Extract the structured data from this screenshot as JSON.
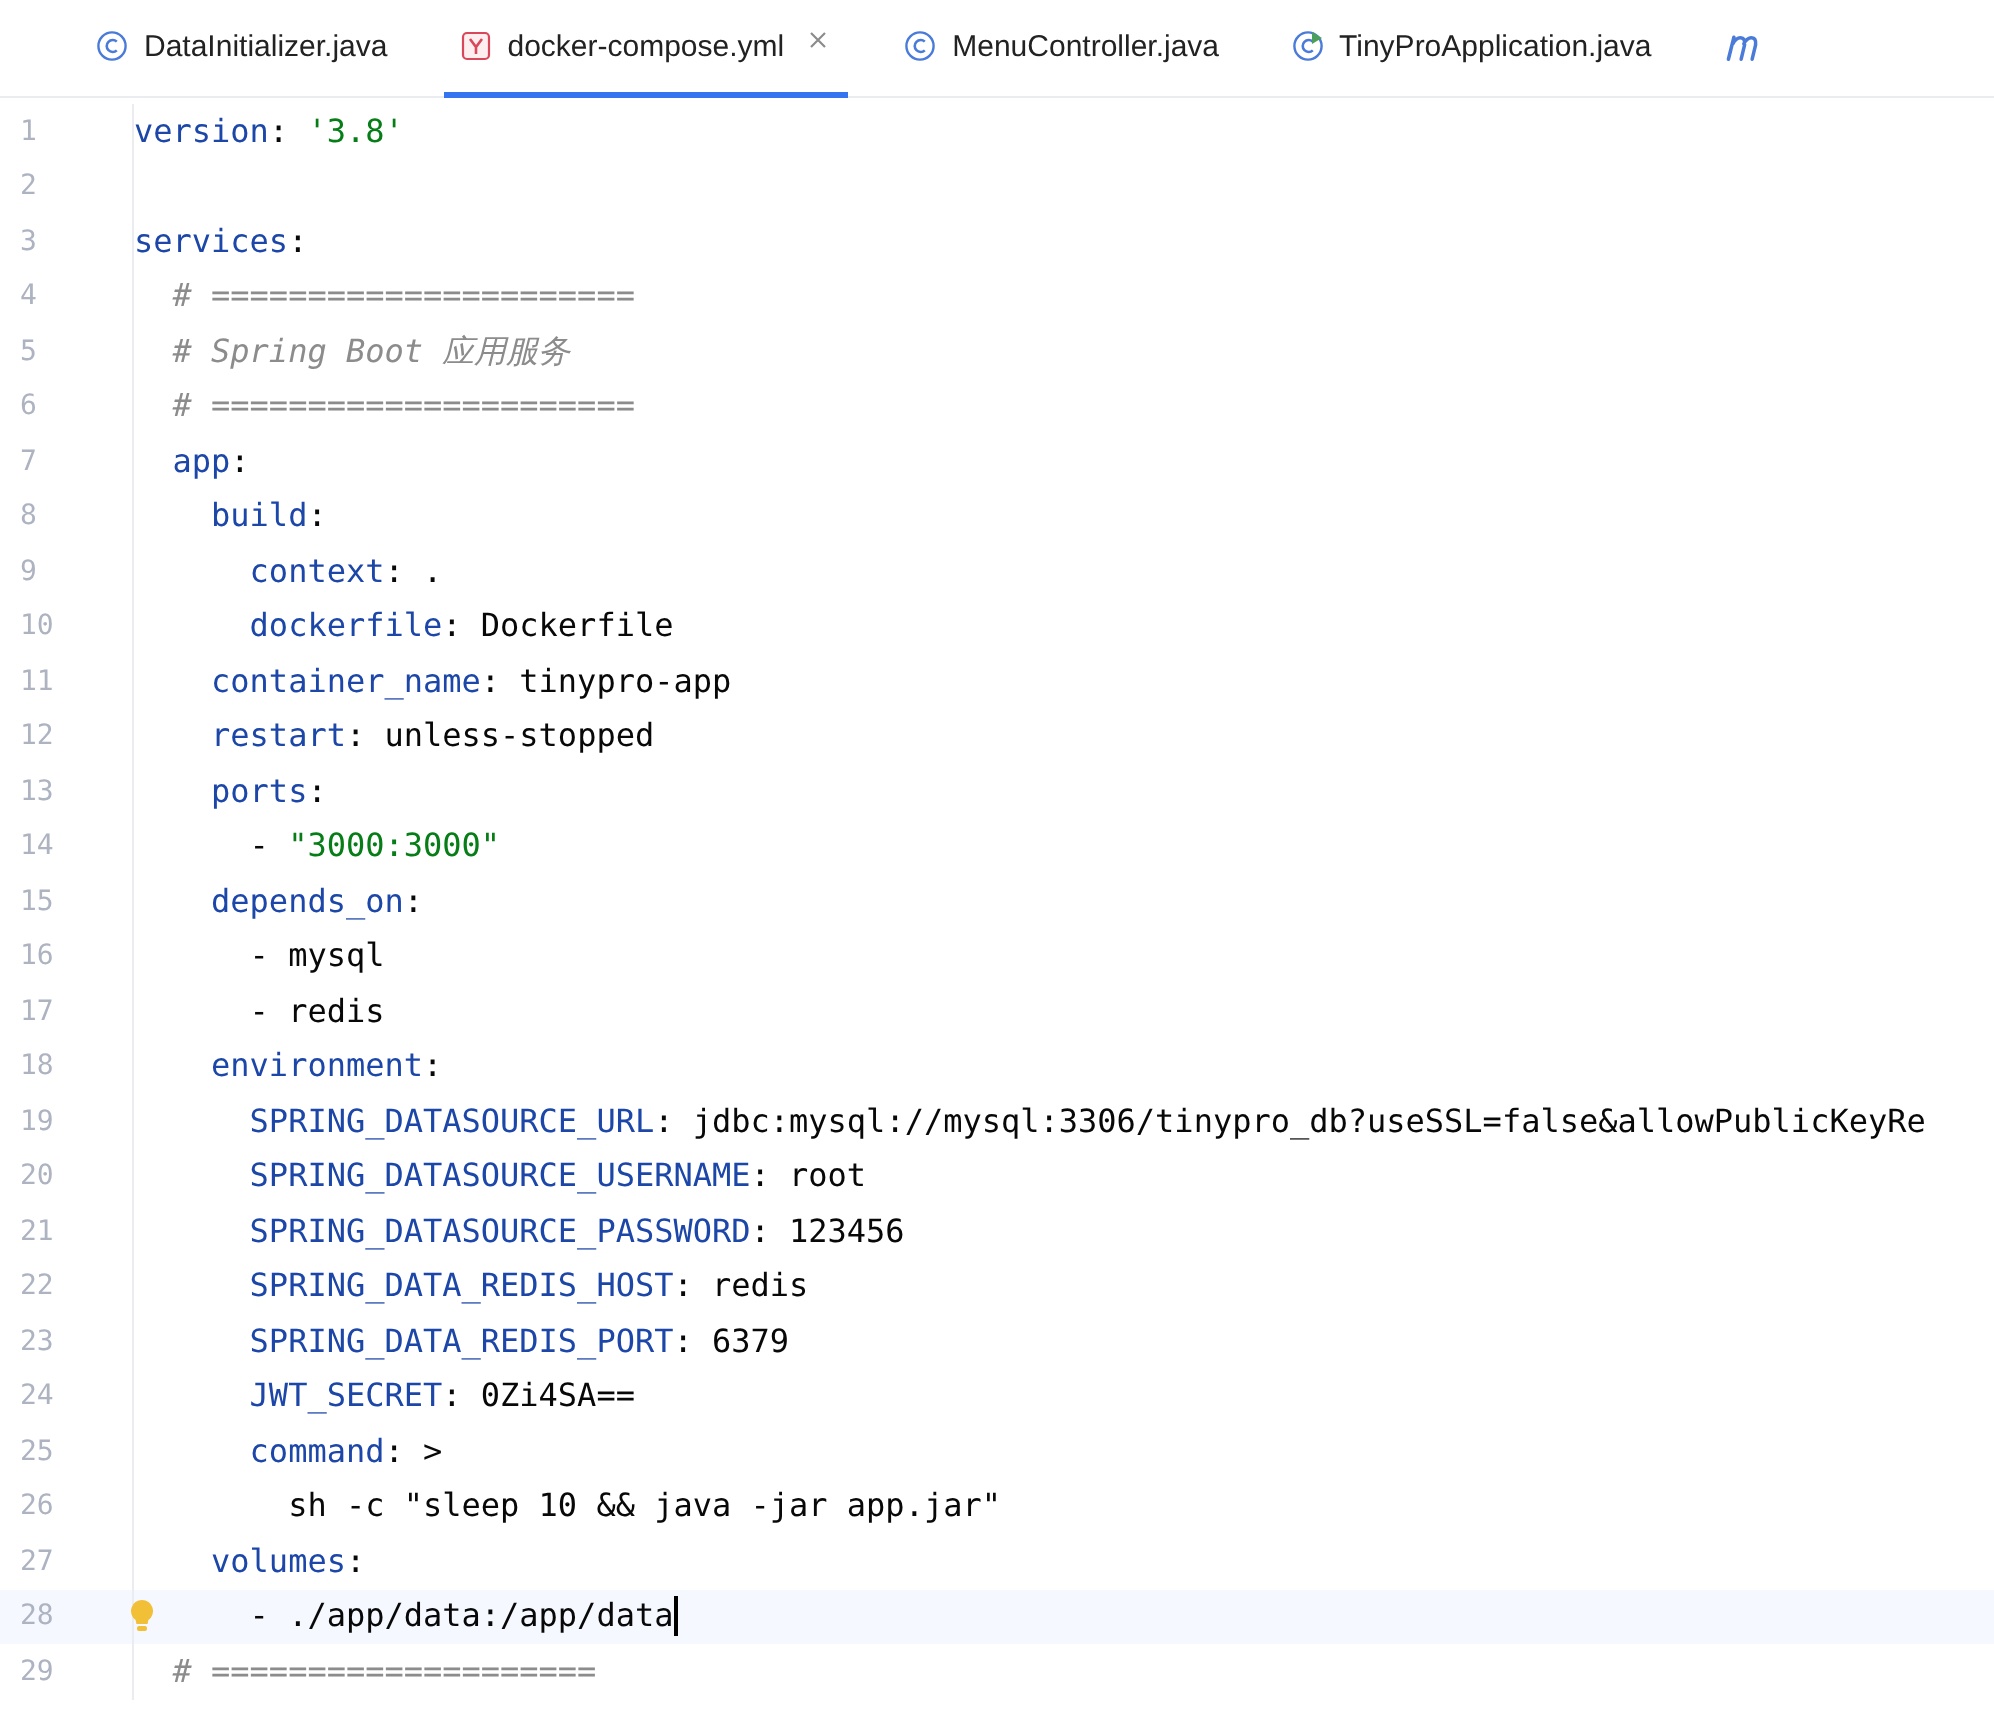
{
  "tabs": [
    {
      "label": "DataInitializer.java",
      "kind": "class",
      "selected": false
    },
    {
      "label": "docker-compose.yml",
      "kind": "yaml",
      "selected": true
    },
    {
      "label": "MenuController.java",
      "kind": "class",
      "selected": false
    },
    {
      "label": "TinyProApplication.java",
      "kind": "app",
      "selected": false
    },
    {
      "kind": "module",
      "selected": false
    }
  ],
  "editor": {
    "lines": [
      {
        "number": "1",
        "tokens": [
          {
            "kind": "key",
            "text": "version"
          },
          {
            "kind": "plain",
            "text": ": "
          },
          {
            "kind": "string",
            "text": "'3.8'"
          }
        ]
      },
      {
        "number": "2"
      },
      {
        "number": "3",
        "tokens": [
          {
            "kind": "key",
            "text": "services"
          },
          {
            "kind": "plain",
            "text": ":"
          }
        ]
      },
      {
        "number": "4",
        "tokens": [
          {
            "kind": "comment",
            "text": "  # ======================"
          }
        ]
      },
      {
        "number": "5",
        "tokens": [
          {
            "kind": "comment",
            "text": "  # Spring Boot 应用服务"
          }
        ]
      },
      {
        "number": "6",
        "tokens": [
          {
            "kind": "comment",
            "text": "  # ======================"
          }
        ]
      },
      {
        "number": "7",
        "tokens": [
          {
            "kind": "key",
            "text": "  app"
          },
          {
            "kind": "plain",
            "text": ":"
          }
        ]
      },
      {
        "number": "8",
        "tokens": [
          {
            "kind": "key",
            "text": "    build"
          },
          {
            "kind": "plain",
            "text": ":"
          }
        ]
      },
      {
        "number": "9",
        "tokens": [
          {
            "kind": "key",
            "text": "      context"
          },
          {
            "kind": "plain",
            "text": ": ."
          }
        ]
      },
      {
        "number": "10",
        "tokens": [
          {
            "kind": "key",
            "text": "      dockerfile"
          },
          {
            "kind": "plain",
            "text": ": Dockerfile"
          }
        ]
      },
      {
        "number": "11",
        "tokens": [
          {
            "kind": "key",
            "text": "    container_name"
          },
          {
            "kind": "plain",
            "text": ": tinypro-app"
          }
        ]
      },
      {
        "number": "12",
        "tokens": [
          {
            "kind": "key",
            "text": "    restart"
          },
          {
            "kind": "plain",
            "text": ": unless-stopped"
          }
        ]
      },
      {
        "number": "13",
        "tokens": [
          {
            "kind": "key",
            "text": "    ports"
          },
          {
            "kind": "plain",
            "text": ":"
          }
        ]
      },
      {
        "number": "14",
        "tokens": [
          {
            "kind": "plain",
            "text": "      - "
          },
          {
            "kind": "string",
            "text": "\"3000:3000\""
          }
        ]
      },
      {
        "number": "15",
        "tokens": [
          {
            "kind": "key",
            "text": "    depends_on"
          },
          {
            "kind": "plain",
            "text": ":"
          }
        ]
      },
      {
        "number": "16",
        "tokens": [
          {
            "kind": "plain",
            "text": "      - mysql"
          }
        ]
      },
      {
        "number": "17",
        "tokens": [
          {
            "kind": "plain",
            "text": "      - redis"
          }
        ]
      },
      {
        "number": "18",
        "tokens": [
          {
            "kind": "key",
            "text": "    environment"
          },
          {
            "kind": "plain",
            "text": ":"
          }
        ]
      },
      {
        "number": "19",
        "tokens": [
          {
            "kind": "key",
            "text": "      SPRING_DATASOURCE_URL"
          },
          {
            "kind": "plain",
            "text": ": jdbc:mysql://mysql:3306/tinypro_db?useSSL=false&allowPublicKeyRe"
          }
        ]
      },
      {
        "number": "20",
        "tokens": [
          {
            "kind": "key",
            "text": "      SPRING_DATASOURCE_USERNAME"
          },
          {
            "kind": "plain",
            "text": ": root"
          }
        ]
      },
      {
        "number": "21",
        "tokens": [
          {
            "kind": "key",
            "text": "      SPRING_DATASOURCE_PASSWORD"
          },
          {
            "kind": "plain",
            "text": ": 123456"
          }
        ]
      },
      {
        "number": "22",
        "tokens": [
          {
            "kind": "key",
            "text": "      SPRING_DATA_REDIS_HOST"
          },
          {
            "kind": "plain",
            "text": ": redis"
          }
        ]
      },
      {
        "number": "23",
        "tokens": [
          {
            "kind": "key",
            "text": "      SPRING_DATA_REDIS_PORT"
          },
          {
            "kind": "plain",
            "text": ": 6379"
          }
        ]
      },
      {
        "number": "24",
        "tokens": [
          {
            "kind": "key",
            "text": "      JWT_SECRET"
          },
          {
            "kind": "plain",
            "text": ": 0Zi4SA=="
          }
        ]
      },
      {
        "number": "25",
        "tokens": [
          {
            "kind": "key",
            "text": "      command"
          },
          {
            "kind": "plain",
            "text": ": >"
          }
        ]
      },
      {
        "number": "26",
        "tokens": [
          {
            "kind": "plain",
            "text": "        sh -c \"sleep 10 && java -jar app.jar\""
          }
        ]
      },
      {
        "number": "27",
        "tokens": [
          {
            "kind": "key",
            "text": "    volumes"
          },
          {
            "kind": "plain",
            "text": ":"
          }
        ]
      },
      {
        "number": "28",
        "current": true,
        "tokens": [
          {
            "kind": "plain",
            "text": "      - ./app/data:/app/data"
          }
        ]
      },
      {
        "number": "29",
        "tokens": [
          {
            "kind": "comment",
            "text": "  # ===================="
          }
        ]
      }
    ]
  }
}
